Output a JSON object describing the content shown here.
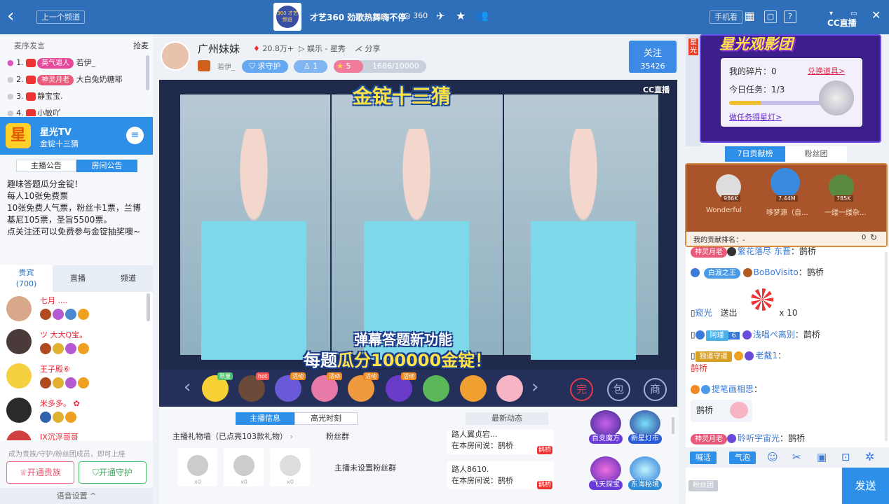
{
  "topbar": {
    "back": "‹",
    "prev_channel": "上一个频道",
    "title": "才艺360 劲歌热舞嗨不停",
    "channel_no": "360",
    "mobile_btn": "手机看",
    "logo": "CC直播",
    "logo_badge": "360 才艺频道"
  },
  "queue": {
    "title": "麦序发言",
    "grab": "抢麦",
    "items": [
      {
        "rank": "1.",
        "badge": "英气逼人",
        "name": "若伊_"
      },
      {
        "rank": "2.",
        "badge": "神灵月老",
        "name": "大白兔奶糖耶"
      },
      {
        "rank": "3.",
        "badge": "",
        "name": "静宝宝."
      },
      {
        "rank": "4.",
        "badge": "",
        "name": "小敏吖"
      }
    ]
  },
  "room": {
    "logo_char": "星",
    "name": "星光TV",
    "sub": "金锭十三猜",
    "tabs": [
      "主播公告",
      "房间公告"
    ],
    "notice": [
      "趣味答题瓜分金锭！",
      "每人10张免费票",
      "10张免费人气票，粉丝卡1票，兰博基尼105票，圣旨5500票。",
      "点关注还可以免费参与金锭抽奖噢~"
    ]
  },
  "aud_tabs": {
    "vip": "贵宾",
    "vip_count": "(700)",
    "live": "直播",
    "channel": "频道"
  },
  "audience": [
    {
      "name": "七月 ...."
    },
    {
      "name": "ツ 大大Q宝。"
    },
    {
      "name": "王子殿⑥"
    },
    {
      "name": "米多多。 ✿"
    },
    {
      "name": "IX沉浮哥哥"
    }
  ],
  "left_bottom": {
    "hint": "成为贵族/守护/粉丝团成员，即可上座",
    "noble": "开通贵族",
    "guard": "开通守护",
    "voice": "语音设置 ^"
  },
  "streamer": {
    "name": "广州妹妹",
    "heat": "20.8万+",
    "category": "娱乐 - 星秀",
    "share": "分享",
    "tag": "若伊_",
    "guard_btn": "求守护",
    "guard_count": "1",
    "level": "5",
    "exp": "1686/10000",
    "follow": "关注",
    "fans": "35426"
  },
  "video": {
    "title": "金锭十三猜",
    "logo": "CC直播",
    "caption1": "弹幕答题新功能",
    "caption2_a": "每题",
    "caption2_b": "瓜分100000金锭！"
  },
  "gifts": [
    {
      "tag": "限量"
    },
    {
      "tag": "hot"
    },
    {
      "tag": "活动"
    },
    {
      "tag": "活动"
    },
    {
      "tag": "活动"
    },
    {
      "tag": "活动"
    },
    {
      "tag": ""
    },
    {
      "tag": ""
    },
    {
      "tag": ""
    }
  ],
  "gift_icons": {
    "prev": "‹",
    "next": "›",
    "c1": "完",
    "c2": "包",
    "c3": "商"
  },
  "info_tabs": {
    "tab1": "主播信息",
    "tab2": "高光时刻",
    "tab3": "最新动态",
    "wall": "主播礼物墙（已点亮103款礼物）",
    "fans": "粉丝群",
    "nofans": "主播未设置粉丝群",
    "counts": [
      "x0",
      "x0",
      "x0"
    ]
  },
  "dynamics": [
    {
      "name": "路人翼贞宕...",
      "text": "在本房间说：鹊桥",
      "tag": "鹊桥"
    },
    {
      "name": "路人8610.",
      "text": "在本房间说：鹊桥",
      "tag": "鹊桥"
    }
  ],
  "plays": [
    {
      "label": "百变魔方"
    },
    {
      "label": "新星灯市"
    },
    {
      "label": "飞天探宝"
    },
    {
      "label": "东海秘境"
    }
  ],
  "side_strip": {
    "label": "星光"
  },
  "starlight": {
    "title": "星光观影团",
    "shards": "我的碎片：0",
    "exchange": "兑换道具>",
    "task": "今日任务：1/3",
    "do_task": "做任务得星灯>",
    "progress": 0.33
  },
  "rank_tabs": {
    "week": "7日贡献榜",
    "fans": "粉丝团"
  },
  "podium": [
    {
      "score": "986K",
      "name": "Wonderful"
    },
    {
      "score": "7.44M",
      "name": "哆梦源（自..."
    },
    {
      "score": "785K",
      "name": "一缕一缕杂..."
    }
  ],
  "my_rank": {
    "label": "我的贡献排名：-",
    "value": "0"
  },
  "chat": [
    {
      "badge": "神灵月老",
      "user": "繁花落尽 东晋",
      "msg": "：鹊桥"
    },
    {
      "badge": "白渡之王",
      "user": "BoBoVisito",
      "msg": "：鹊桥"
    },
    {
      "user": "窥光",
      "msg": "送出",
      "count": "x 10"
    },
    {
      "badge": "阿瑾",
      "lvl": "6",
      "user": "浅唱ぺ离别",
      "msg": "：鹊桥"
    },
    {
      "badge": "独道守道",
      "user": "老戴1",
      "msg": "：",
      "msg2": "鹊桥"
    },
    {
      "user": "提笔画相思",
      "msg": "：",
      "msg2": "鹊桥"
    },
    {
      "badge": "神灵月老",
      "user": "聆听宇宙光",
      "msg": "：鹊桥"
    }
  ],
  "input": {
    "tab1": "喊话",
    "tab2": "气泡",
    "fans_group": "粉丝团",
    "send": "发送"
  }
}
